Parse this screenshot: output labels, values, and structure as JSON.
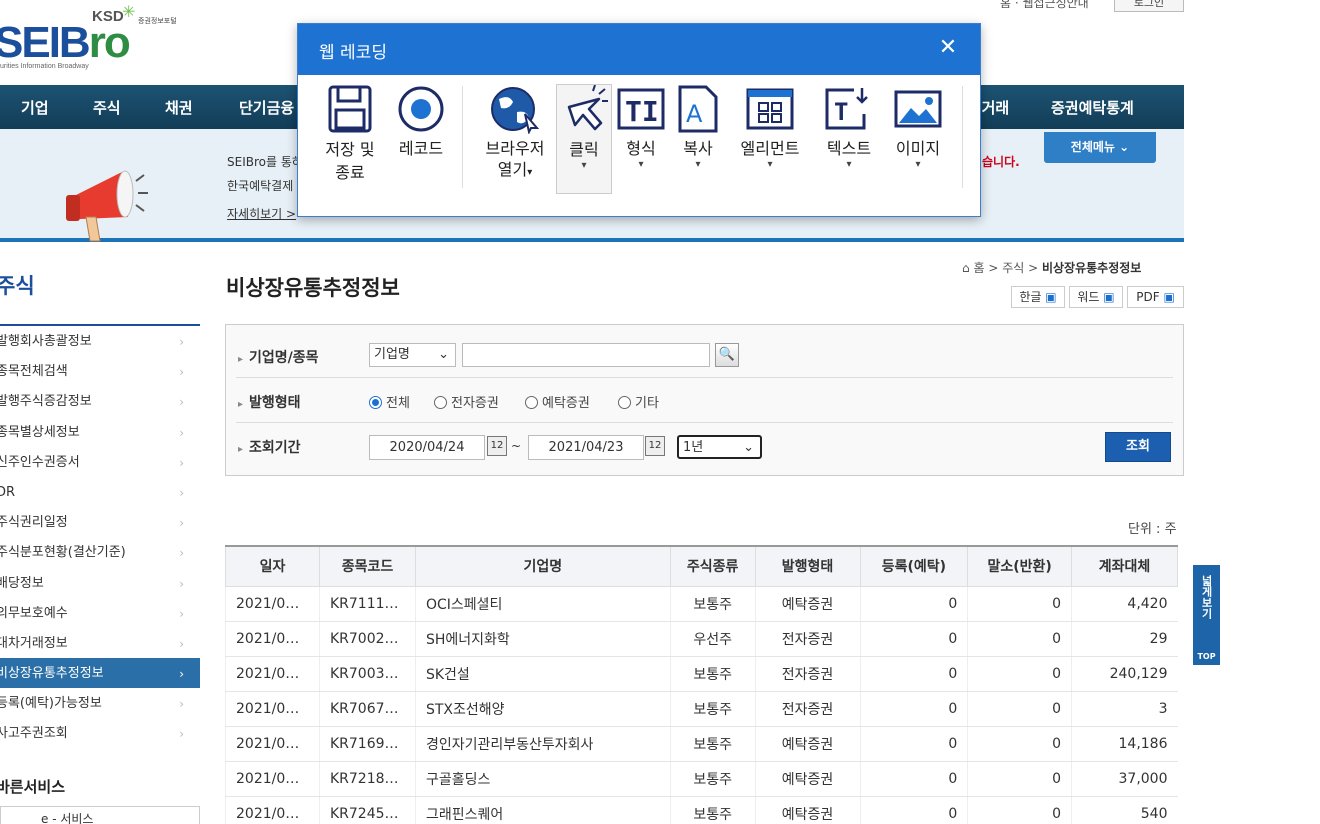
{
  "header": {
    "logo_ksd": "KSD",
    "logo_ksd_sub": "증권정보포털",
    "logo_brand_a": "SEIB",
    "logo_brand_b": "ro",
    "logo_tagline": "urities Information Broadway",
    "util_link": "홈 · 웹접근성안내",
    "login": "로그인"
  },
  "gnb": [
    "기업",
    "주식",
    "채권",
    "단기금융",
    "장외거래",
    "증권예탁통계"
  ],
  "banner": {
    "line1": "SEIBro를 통하",
    "line2": "한국예탁결제",
    "more": "자세히보기 >",
    "notice": "습니다.",
    "all_menu": "전체메뉴"
  },
  "lnb": {
    "title": "주식",
    "items": [
      "발행회사총괄정보",
      "종목전체검색",
      "발행주식증감정보",
      "종목별상세정보",
      "신주인수권증서",
      "DR",
      "주식권리일정",
      "주식분포현황(결산기준)",
      "배당정보",
      "의무보호예수",
      "대차거래정보",
      "비상장유통추정정보",
      "등록(예탁)가능정보",
      "사고주권조회"
    ],
    "active_index": 11,
    "sub_title": "바른서비스",
    "eservice": "e - 서비스"
  },
  "page": {
    "title": "비상장유통추정정보",
    "breadcrumb": [
      "홈",
      "주식",
      "비상장유통추정정보"
    ],
    "file_buttons": [
      "한글",
      "워드",
      "PDF"
    ]
  },
  "search": {
    "company_label": "기업명/종목",
    "company_select": "기업명",
    "company_value": "",
    "type_label": "발행형태",
    "type_options": [
      "전체",
      "전자증권",
      "예탁증권",
      "기타"
    ],
    "type_selected": "전체",
    "period_label": "조회기간",
    "date_from": "2020/04/24",
    "date_to": "2021/04/23",
    "date_sep": "~",
    "period_select": "1년",
    "submit": "조회"
  },
  "unit_text": "단위 : 주",
  "table": {
    "headers": [
      "일자",
      "종목코드",
      "기업명",
      "주식종류",
      "발행형태",
      "등록(예탁)",
      "말소(반환)",
      "계좌대체"
    ],
    "rows": [
      [
        "2021/0…",
        "KR7111…",
        "OCI스페셜티",
        "보통주",
        "예탁증권",
        "0",
        "0",
        "4,420"
      ],
      [
        "2021/0…",
        "KR7002…",
        "SH에너지화학",
        "우선주",
        "전자증권",
        "0",
        "0",
        "29"
      ],
      [
        "2021/0…",
        "KR7003…",
        "SK건설",
        "보통주",
        "전자증권",
        "0",
        "0",
        "240,129"
      ],
      [
        "2021/0…",
        "KR7067…",
        "STX조선해양",
        "보통주",
        "전자증권",
        "0",
        "0",
        "3"
      ],
      [
        "2021/0…",
        "KR7169…",
        "경인자기관리부동산투자회사",
        "보통주",
        "예탁증권",
        "0",
        "0",
        "14,186"
      ],
      [
        "2021/0…",
        "KR7218…",
        "구골홀딩스",
        "보통주",
        "예탁증권",
        "0",
        "0",
        "37,000"
      ],
      [
        "2021/0…",
        "KR7245…",
        "그래핀스퀘어",
        "보통주",
        "예탁증권",
        "0",
        "0",
        "540"
      ]
    ]
  },
  "side_tab": {
    "label": "넓게보기",
    "top": "TOP"
  },
  "dialog": {
    "title": "웹 레코딩",
    "tools": [
      {
        "icon": "save-icon",
        "label1": "저장 및",
        "label2": "종료"
      },
      {
        "icon": "record-icon",
        "label1": "레코드",
        "label2": ""
      },
      {
        "icon": "browser-globe-icon",
        "label1": "브라우저",
        "label2": "열기"
      },
      {
        "icon": "click-cursor-icon",
        "label1": "클릭",
        "label2": ""
      },
      {
        "icon": "text-field-icon",
        "label1": "형식",
        "label2": ""
      },
      {
        "icon": "copy-document-icon",
        "label1": "복사",
        "label2": ""
      },
      {
        "icon": "element-grid-icon",
        "label1": "엘리먼트",
        "label2": ""
      },
      {
        "icon": "text-extract-icon",
        "label1": "텍스트",
        "label2": ""
      },
      {
        "icon": "image-icon",
        "label1": "이미지",
        "label2": ""
      }
    ],
    "caret": "▾",
    "accent": "#1e72d2"
  }
}
